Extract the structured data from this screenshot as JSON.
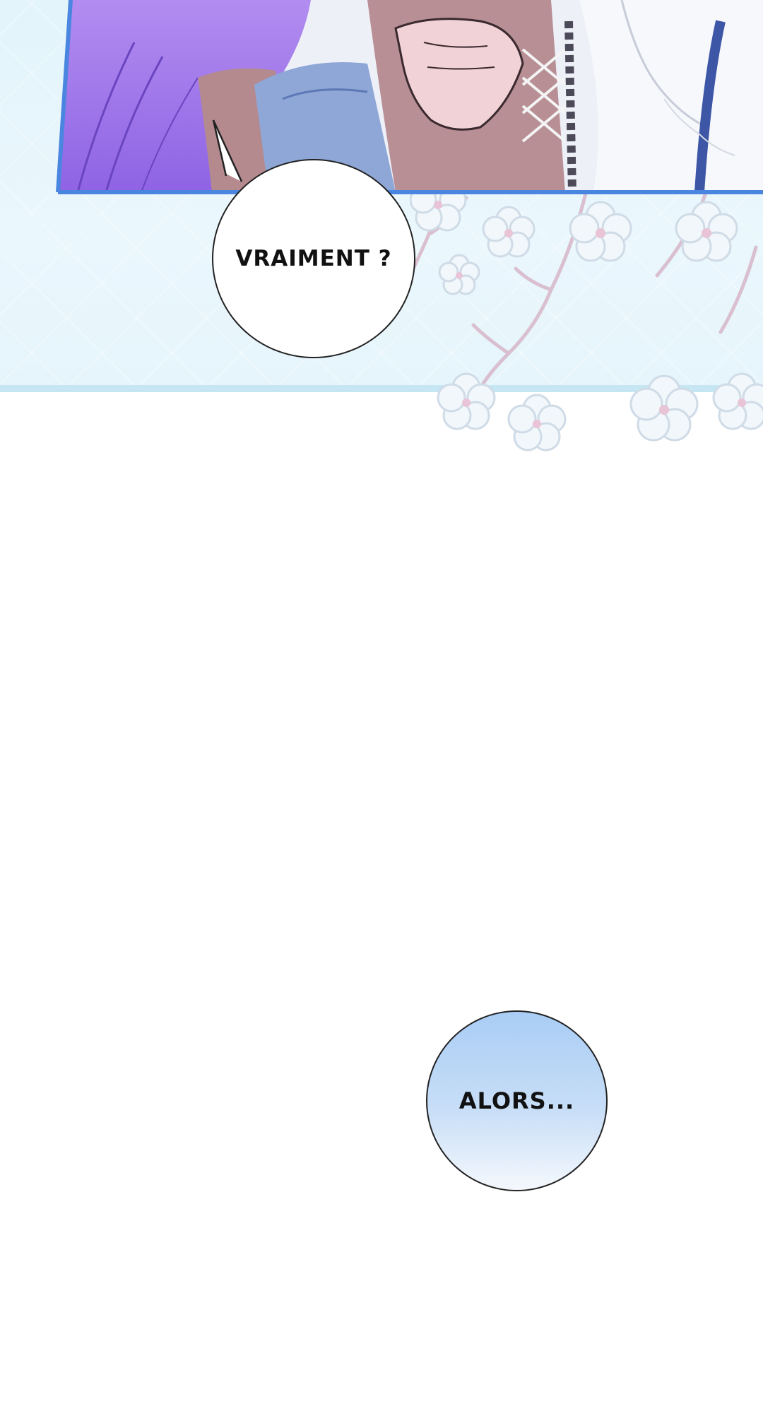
{
  "bubbles": {
    "first": "VRAIMENT ?",
    "second": "ALORS..."
  },
  "colors": {
    "panel_border": "#4a86e0",
    "background_strip": "#e6f5fc",
    "bubble_fill_white": "#ffffff",
    "bubble_fill_blue": "#a9cdf5"
  }
}
